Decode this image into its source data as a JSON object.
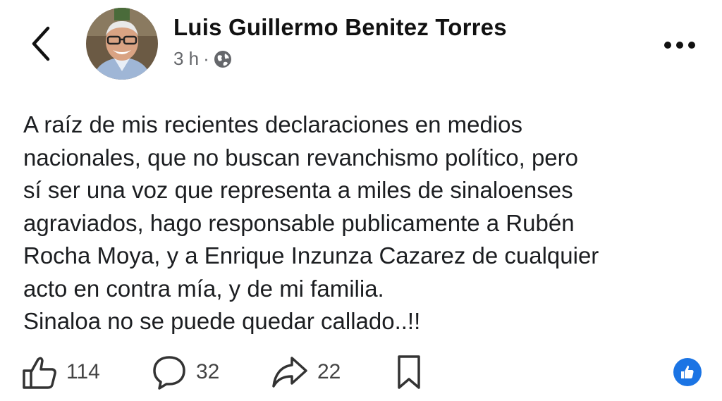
{
  "author": {
    "name": "Luis Guillermo Benitez Torres",
    "time": "3 h",
    "separator": "·"
  },
  "post": {
    "lines": [
      "A raíz de mis recientes declaraciones en medios",
      "nacionales, que no buscan revanchismo político, pero",
      "sí ser una voz que representa a miles de sinaloenses",
      "agraviados, hago responsable publicamente a Rubén",
      "Rocha Moya, y a Enrique Inzunza Cazarez de cualquier",
      "acto en contra mía, y de mi familia.",
      "Sinaloa no se puede quedar callado..!!"
    ]
  },
  "stats": {
    "likes": "114",
    "comments": "32",
    "shares": "22"
  },
  "icons": {
    "back": "chevron-left-icon",
    "privacy": "globe-icon",
    "more": "more-options-icon",
    "like": "thumbs-up-icon",
    "comment": "comment-bubble-icon",
    "share": "share-arrow-icon",
    "save": "bookmark-icon",
    "reaction": "like-reaction-icon"
  },
  "colors": {
    "accent": "#1b74e4",
    "meta_text": "#65676b",
    "text": "#1c1e21"
  }
}
